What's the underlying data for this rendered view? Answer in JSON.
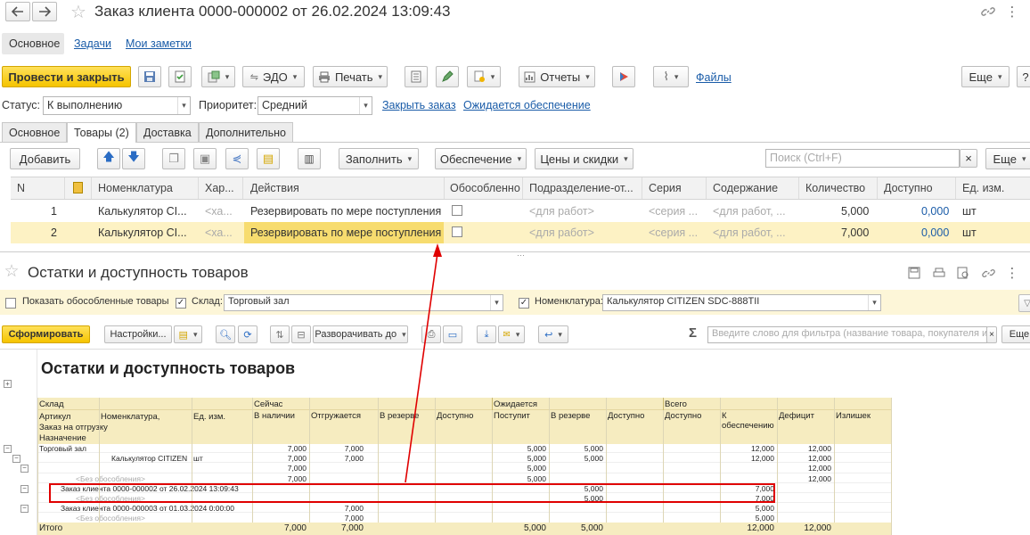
{
  "window": {
    "title": "Заказ клиента 0000-000002 от 26.02.2024 13:09:43"
  },
  "nav": {
    "main": "Основное",
    "tasks": "Задачи",
    "notes": "Мои заметки"
  },
  "toolbar": {
    "post_close": "Провести и закрыть",
    "edo": "ЭДО",
    "print": "Печать",
    "reports": "Отчеты",
    "files": "Файлы",
    "more": "Еще",
    "help": "?"
  },
  "status": {
    "status_label": "Статус:",
    "status_value": "К выполнению",
    "priority_label": "Приоритет:",
    "priority_value": "Средний",
    "close_order": "Закрыть заказ",
    "awaiting": "Ожидается обеспечение"
  },
  "tabs": [
    "Основное",
    "Товары (2)",
    "Доставка",
    "Дополнительно"
  ],
  "goods_toolbar": {
    "add": "Добавить",
    "fill": "Заполнить",
    "provision": "Обеспечение",
    "prices": "Цены и скидки",
    "search_placeholder": "Поиск (Ctrl+F)",
    "clear": "×",
    "more": "Еще"
  },
  "goods_table": {
    "columns": [
      "N",
      "Номенклатура",
      "Хар...",
      "Действия",
      "Обособленно",
      "Подразделение-от...",
      "Серия",
      "Содержание",
      "Количество",
      "Доступно",
      "Ед. изм."
    ],
    "rows": [
      {
        "n": "1",
        "item": "Калькулятор CI...",
        "char": "<ха...",
        "action": "Резервировать по мере поступления",
        "dept": "<для работ>",
        "series": "<серия ...",
        "content": "<для работ, ...",
        "qty": "5,000",
        "avail": "0,000",
        "unit": "шт"
      },
      {
        "n": "2",
        "item": "Калькулятор CI...",
        "char": "<ха...",
        "action": "Резервировать по мере поступления",
        "dept": "<для работ>",
        "series": "<серия ...",
        "content": "<для работ, ...",
        "qty": "7,000",
        "avail": "0,000",
        "unit": "шт"
      }
    ]
  },
  "report_panel": {
    "title": "Остатки и доступность товаров",
    "show_separate": "Показать обособленные товары",
    "warehouse_label": "Склад:",
    "warehouse_value": "Торговый зал",
    "item_label": "Номенклатура:",
    "item_value": "Калькулятор CITIZEN SDC-888TII",
    "generate": "Сформировать",
    "settings": "Настройки...",
    "expand": "Разворачивать до",
    "sum_icon": "Σ",
    "filter_placeholder": "Введите слово для фильтра (название товара, покупателя и",
    "more": "Еще"
  },
  "report": {
    "heading": "Остатки и доступность товаров",
    "h_warehouse": "Склад",
    "h_article": "Артикул",
    "h_item": "Номенклатура,",
    "h_unit": "Ед. изм.",
    "h_ship_order": "Заказ на отгрузку",
    "h_purpose": "Назначение",
    "g_now": "Сейчас",
    "g_expected": "Ожидается",
    "g_total": "Всего",
    "cols": [
      "В наличии",
      "Отгружается",
      "В резерве",
      "Доступно",
      "Поступит",
      "В резерве",
      "Доступно",
      "Доступно",
      "К обеспечению",
      "Дефицит",
      "Излишек"
    ],
    "rows": [
      {
        "label": "Торговый зал",
        "v": [
          "7,000",
          "7,000",
          "",
          "",
          "5,000",
          "5,000",
          "",
          "",
          "12,000",
          "12,000",
          ""
        ]
      },
      {
        "label": "Калькулятор CITIZEN",
        "unit": "шт",
        "v": [
          "7,000",
          "7,000",
          "",
          "",
          "5,000",
          "5,000",
          "",
          "",
          "12,000",
          "12,000",
          ""
        ]
      },
      {
        "label": "",
        "v": [
          "7,000",
          "",
          "",
          "",
          "5,000",
          "",
          "",
          "",
          "",
          "12,000",
          ""
        ]
      },
      {
        "label": "<Без обособления>",
        "v": [
          "7,000",
          "",
          "",
          "",
          "5,000",
          "",
          "",
          "",
          "",
          "12,000",
          ""
        ]
      },
      {
        "label": "Заказ клиента 0000-000002 от 26.02.2024 13:09:43",
        "v": [
          "",
          "",
          "",
          "",
          "",
          "5,000",
          "",
          "",
          "7,000",
          "",
          ""
        ]
      },
      {
        "label": "<Без обособления>",
        "v": [
          "",
          "",
          "",
          "",
          "",
          "5,000",
          "",
          "",
          "7,000",
          "",
          ""
        ]
      },
      {
        "label": "Заказ клиента 0000-000003 от 01.03.2024 0:00:00",
        "v": [
          "",
          "7,000",
          "",
          "",
          "",
          "",
          "",
          "",
          "5,000",
          "",
          ""
        ]
      },
      {
        "label": "<Без обособления>",
        "v": [
          "",
          "7,000",
          "",
          "",
          "",
          "",
          "",
          "",
          "5,000",
          "",
          ""
        ]
      }
    ],
    "total_label": "Итого",
    "total": [
      "7,000",
      "7,000",
      "",
      "",
      "5,000",
      "5,000",
      "",
      "",
      "12,000",
      "12,000",
      ""
    ]
  },
  "colors": {
    "accent_yellow": "#f5c400",
    "highlight_row": "#fdf2c4",
    "link_blue": "#1a5ca8",
    "annotation_red": "#e00000"
  }
}
